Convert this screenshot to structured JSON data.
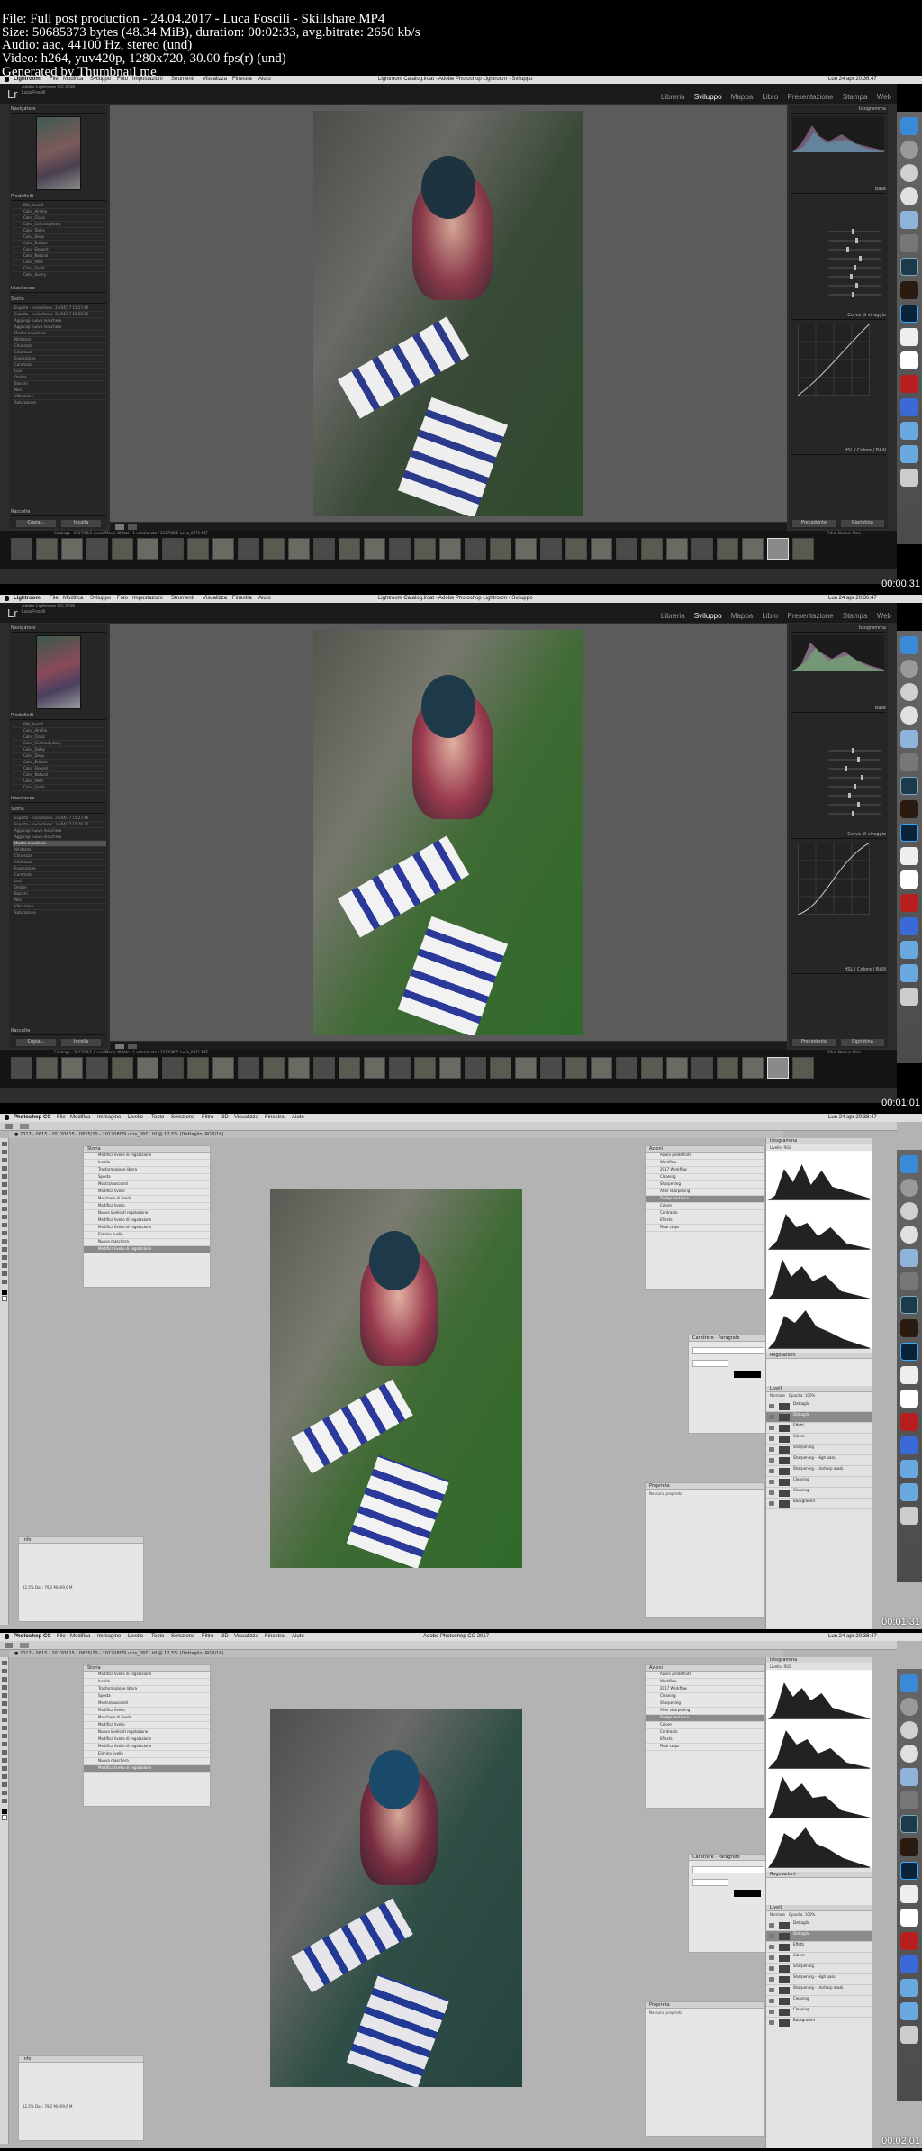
{
  "header": {
    "lines": [
      "File: Full post production - 24.04.2017 - Luca Foscili - Skillshare.MP4",
      "Size: 50685373 bytes (48.34 MiB), duration: 00:02:33, avg.bitrate: 2650 kb/s",
      "Audio: aac, 44100 Hz, stereo (und)",
      "Video: h264, yuv420p, 1280x720, 30.00 fps(r) (und)",
      "Generated by Thumbnail me"
    ]
  },
  "lightroom": {
    "app_name": "Lightroom",
    "menus": [
      "File",
      "Modifica",
      "Sviluppo",
      "Foto",
      "Impostazioni",
      "Strumenti",
      "Visualizza",
      "Finestra",
      "Aiuto"
    ],
    "window_title": "Lightroom Catalog.lrcat - Adobe Photoshop Lightroom - Sviluppo",
    "clock": "Lun 24 apr 20:36:47",
    "logo": "Lr",
    "catalog_line1": "Adobe Lightroom CC 2015",
    "catalog_line2": "Luca Foscili",
    "modules": [
      "Libreria",
      "Sviluppo",
      "Mappa",
      "Libro",
      "Presentazione",
      "Stampa",
      "Web"
    ],
    "navigator_label": "Navigatore",
    "presets_label": "Predefiniti",
    "presets": [
      "BW_Bwsoft",
      "Color_Airellia",
      "Color_Clasic",
      "Color_Contrastydarg",
      "Color_Daley",
      "Color_Deep",
      "Color_Eclipse",
      "Color_Elegant",
      "Color_Natural",
      "Color_Pelle",
      "Color_Quiet",
      "Color_Sunny"
    ],
    "snapshots_label": "Istantanee",
    "history_label": "Storia",
    "history": [
      "Esporta - Invia dissoc. 24/04/17 15:27:46",
      "Esporta - Invia dissoc. 24/04/17 15:26:20",
      "Aggiungi nuova maschera",
      "Aggiungi nuova maschera",
      "Mostra maschera",
      "Nitidezza",
      "Chiarezza",
      "Chiarezza",
      "Esposizione",
      "Contrasto",
      "Luci",
      "Ombre",
      "Bianchi",
      "Neri",
      "Vibrazione",
      "Saturazione"
    ],
    "collections_label": "Raccolte",
    "copy_button": "Copia...",
    "paste_button": "Incolla",
    "previous_button": "Precedente",
    "reset_button": "Ripristina",
    "filter_label": "Filtro:",
    "filter_value": "Nessun filtro",
    "filmstrip_info": "Catalogo - 2017/08/1 (Lucia/Mast) 38 foto / 1 selezionata / 20170805 Lucia_0971.NEF",
    "histogram_label": "Istogramma",
    "basic_label": "Base",
    "tone_curve_label": "Curva di viraggio",
    "hsl_label": "HSL / Colore / B&N",
    "timestamps": [
      "00:00:31",
      "00:01:01"
    ]
  },
  "photoshop": {
    "app_name": "Photoshop CC",
    "menus": [
      "File",
      "Modifica",
      "Immagine",
      "Livello",
      "Testo",
      "Selezione",
      "Filtro",
      "3D",
      "Visualizza",
      "Finestra",
      "Aiuto"
    ],
    "window_title": "Adobe Photoshop CC 2017",
    "clock": "Lun 24 apr 20:38:47",
    "doc_tab": "● 2017 - 0815 - 20170815 - 0825/20 - 20170805Lucia_0971.tif @ 12,5% (Dettaglio, RGB/16)",
    "history_panel_label": "Storia",
    "history_items": [
      "Modifica livello di regolazione",
      "Incolla",
      "Trasformazione libera",
      "Sposta",
      "Mostra/nascondi",
      "Modifica livello",
      "Maschera di livello",
      "Modifica livello",
      "Nuovo livello di regolazione",
      "Modifica livello di regolazione",
      "Modifica livello di regolazione",
      "Elimina livello",
      "Nuova maschera",
      "Modifica livello di regolazione"
    ],
    "actions_panel_label": "Azioni",
    "actions_items": [
      "Azioni predefinite",
      "Workflow",
      "2017 Workflow",
      "Cleaning",
      "Sharpening",
      "After sharpening",
      "Dodge and burn",
      "Colore",
      "Contrasto",
      "Effects",
      "Final steps"
    ],
    "layers_label": "Livelli",
    "layers_blend": "Normale",
    "opacity_label": "Opacita: 100%",
    "layers": [
      "Dettaglio",
      "Dettaglio",
      "Effetti",
      "Colore",
      "Sharpening",
      "Sharpening - High pass",
      "Sharpening - Unsharp mask",
      "Cleaning",
      "Cleaning",
      "Background"
    ],
    "info_label": "Info",
    "properties_label": "Proprieta",
    "properties_text": "Nessuna proprieta",
    "character_label": "Carattere",
    "paragraph_label": "Paragrafo",
    "adjustments_label": "Regolazioni",
    "histogram_label": "Istogramma",
    "histogram_source": "Livello: RGB",
    "doc_status": "12,5% Doc: 79,2 M/409,6 M",
    "timestamps": [
      "00:01:31",
      "00:02:01"
    ]
  }
}
